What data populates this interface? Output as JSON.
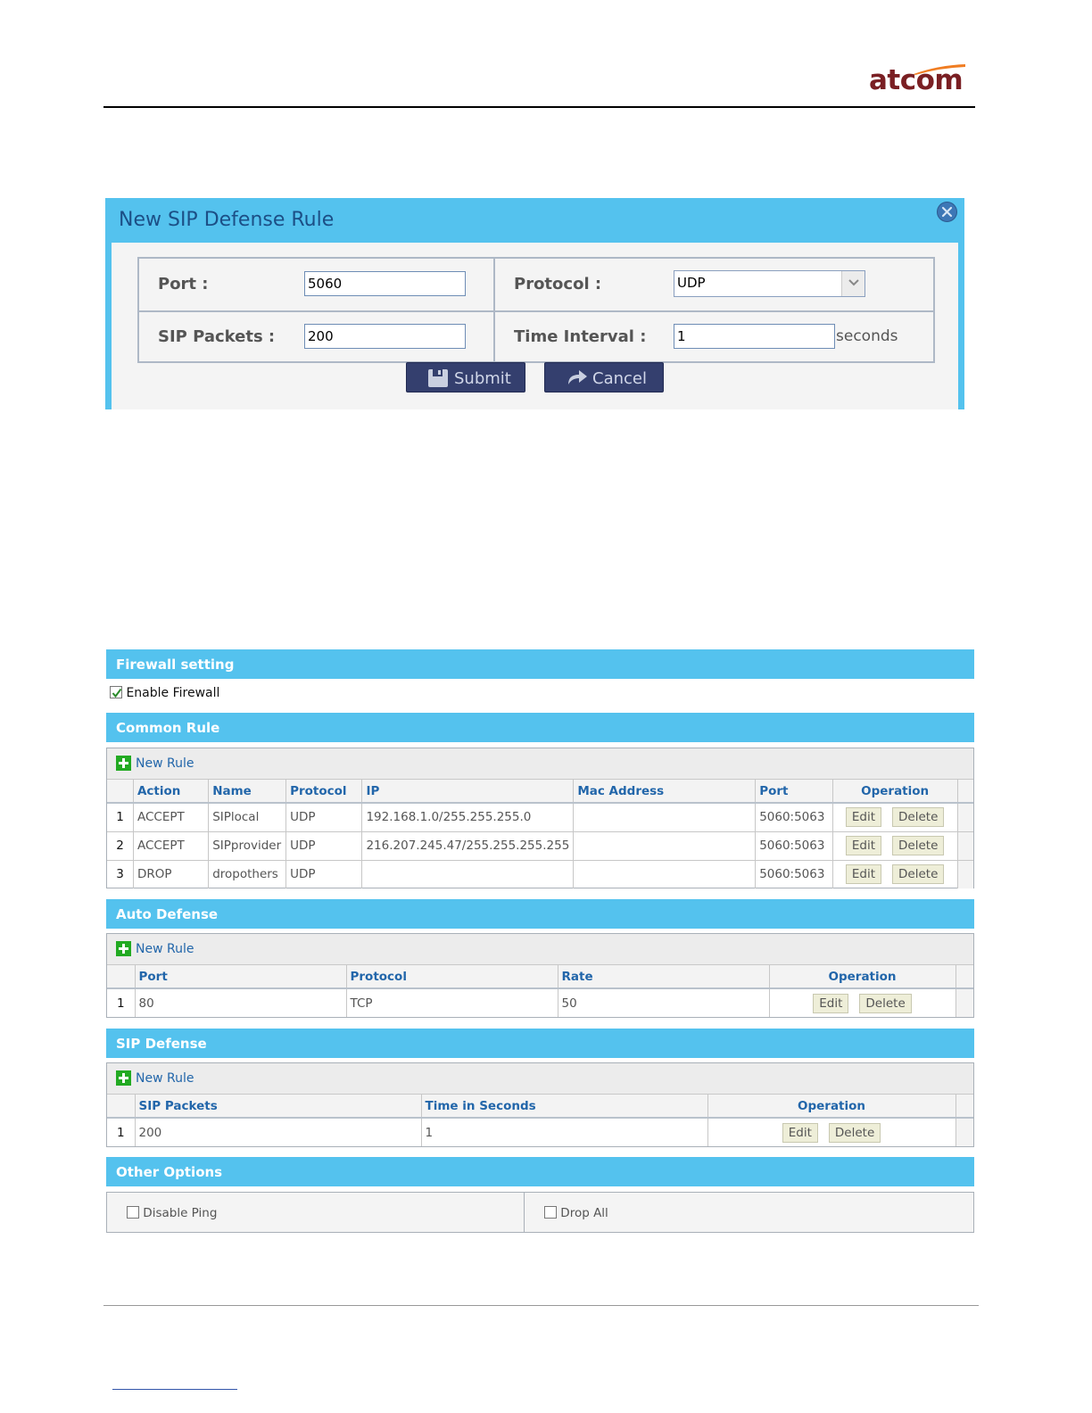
{
  "header": {
    "logo_text": "atcom"
  },
  "dialog": {
    "title": "New SIP Defense Rule",
    "port_label": "Port :",
    "port_value": "5060",
    "protocol_label": "Protocol :",
    "protocol_value": "UDP",
    "sip_packets_label": "SIP Packets :",
    "sip_packets_value": "200",
    "time_interval_label": "Time Interval :",
    "time_interval_value": "1",
    "time_unit": "seconds",
    "submit_label": "Submit",
    "cancel_label": "Cancel"
  },
  "firewall": {
    "section_title": "Firewall setting",
    "enable_label": "Enable Firewall",
    "enabled": true
  },
  "common_rule": {
    "section_title": "Common Rule",
    "new_rule_label": "New Rule",
    "columns": [
      "Action",
      "Name",
      "Protocol",
      "IP",
      "Mac Address",
      "Port",
      "Operation"
    ],
    "rows": [
      {
        "n": "1",
        "action": "ACCEPT",
        "name": "SIPlocal",
        "protocol": "UDP",
        "ip": "192.168.1.0/255.255.255.0",
        "mac": "",
        "port": "5060:5063"
      },
      {
        "n": "2",
        "action": "ACCEPT",
        "name": "SIPprovider",
        "protocol": "UDP",
        "ip": "216.207.245.47/255.255.255.255",
        "mac": "",
        "port": "5060:5063"
      },
      {
        "n": "3",
        "action": "DROP",
        "name": "dropothers",
        "protocol": "UDP",
        "ip": "",
        "mac": "",
        "port": "5060:5063"
      }
    ]
  },
  "auto_defense": {
    "section_title": "Auto Defense",
    "new_rule_label": "New Rule",
    "columns": [
      "Port",
      "Protocol",
      "Rate",
      "Operation"
    ],
    "rows": [
      {
        "n": "1",
        "port": "80",
        "protocol": "TCP",
        "rate": "50"
      }
    ]
  },
  "sip_defense": {
    "section_title": "SIP Defense",
    "new_rule_label": "New Rule",
    "columns": [
      "SIP Packets",
      "Time in Seconds",
      "Operation"
    ],
    "rows": [
      {
        "n": "1",
        "packets": "200",
        "seconds": "1"
      }
    ]
  },
  "other_options": {
    "section_title": "Other Options",
    "disable_ping_label": "Disable Ping",
    "drop_all_label": "Drop All"
  },
  "buttons": {
    "edit": "Edit",
    "delete": "Delete"
  },
  "colors": {
    "section_header": "#54c2ee",
    "dialog_button": "#343f6e",
    "logo": "#7a1f23",
    "logo_accent": "#f07d22",
    "link_blue": "#2266aa"
  }
}
